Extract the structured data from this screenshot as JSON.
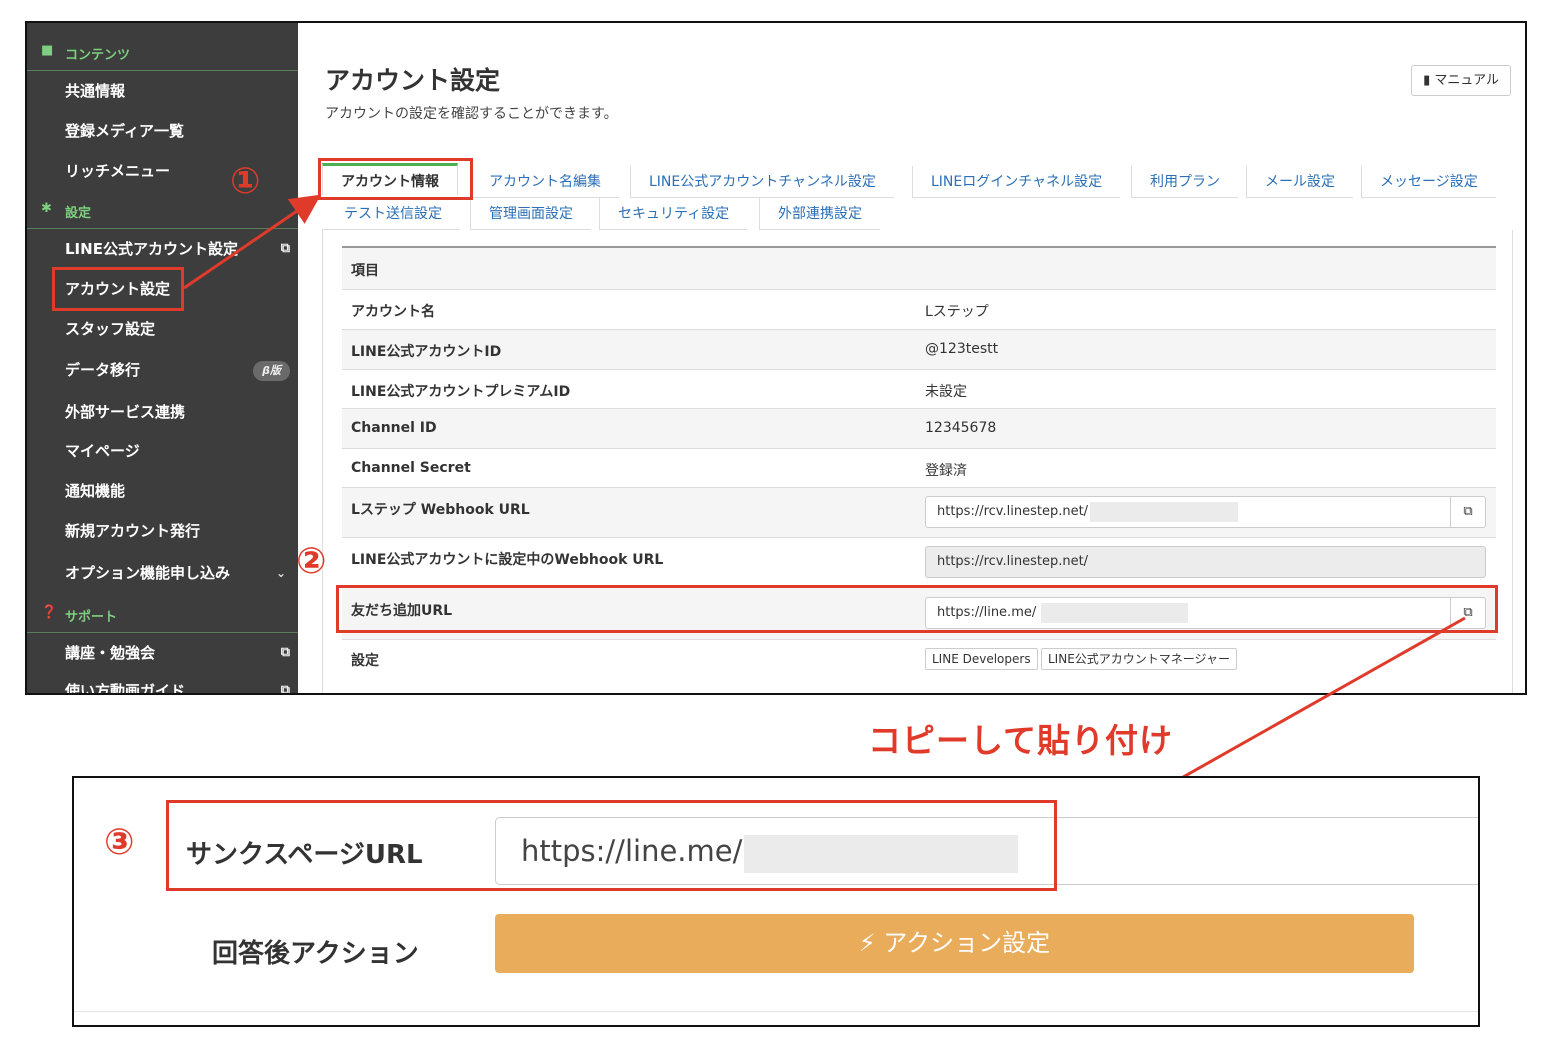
{
  "sidebar": {
    "contents_section": "コンテンツ",
    "contents_items": [
      "共通情報",
      "登録メディア一覧",
      "リッチメニュー"
    ],
    "settings_section": "設定",
    "settings_items": [
      "LINE公式アカウント設定",
      "アカウント設定",
      "スタッフ設定",
      "データ移行",
      "外部サービス連携",
      "マイページ",
      "通知機能",
      "新規アカウント発行",
      "オプション機能申し込み"
    ],
    "beta_badge": "β版",
    "support_section": "サポート",
    "support_items": [
      "講座・勉強会",
      "使い方動画ガイド"
    ]
  },
  "header": {
    "title": "アカウント設定",
    "subtitle": "アカウントの設定を確認することができます。",
    "manual_button": "マニュアル"
  },
  "tabs": {
    "row1": [
      "アカウント情報",
      "アカウント名編集",
      "LINE公式アカウントチャンネル設定",
      "LINEログインチャネル設定",
      "利用プラン",
      "メール設定",
      "メッセージ設定"
    ],
    "row2": [
      "テスト送信設定",
      "管理画面設定",
      "セキュリティ設定",
      "外部連携設定"
    ],
    "active": "アカウント情報"
  },
  "table": {
    "header": "項目",
    "rows": [
      {
        "key": "アカウント名",
        "value": "Lステップ"
      },
      {
        "key": "LINE公式アカウントID",
        "value": "@123testt"
      },
      {
        "key": "LINE公式アカウントプレミアムID",
        "value": "未設定"
      },
      {
        "key": "Channel ID",
        "value": "12345678"
      },
      {
        "key": "Channel Secret",
        "value": "登録済"
      },
      {
        "key": "Lステップ Webhook URL",
        "value": "https://rcv.linestep.net/"
      },
      {
        "key": "LINE公式アカウントに設定中のWebhook URL",
        "value": "https://rcv.linestep.net/"
      },
      {
        "key": "友だち追加URL",
        "value": "https://line.me/"
      },
      {
        "key": "設定",
        "value": ""
      }
    ],
    "setting_buttons": [
      "LINE Developers",
      "LINE公式アカウントマネージャー"
    ]
  },
  "annotations": {
    "step1": "①",
    "step2": "②",
    "step3": "③",
    "copy_note": "コピーして貼り付け",
    "accent": "#e03a2a"
  },
  "thanks_form": {
    "thanks_label": "サンクスページURL",
    "thanks_value": "https://line.me/",
    "action_label": "回答後アクション",
    "action_button": "⚡ アクション設定"
  },
  "colors": {
    "sidebar_bg": "#3d3d3d",
    "section_green": "#7dd07d",
    "tab_link": "#2a6fb7",
    "action_button": "#e8ac5a"
  }
}
